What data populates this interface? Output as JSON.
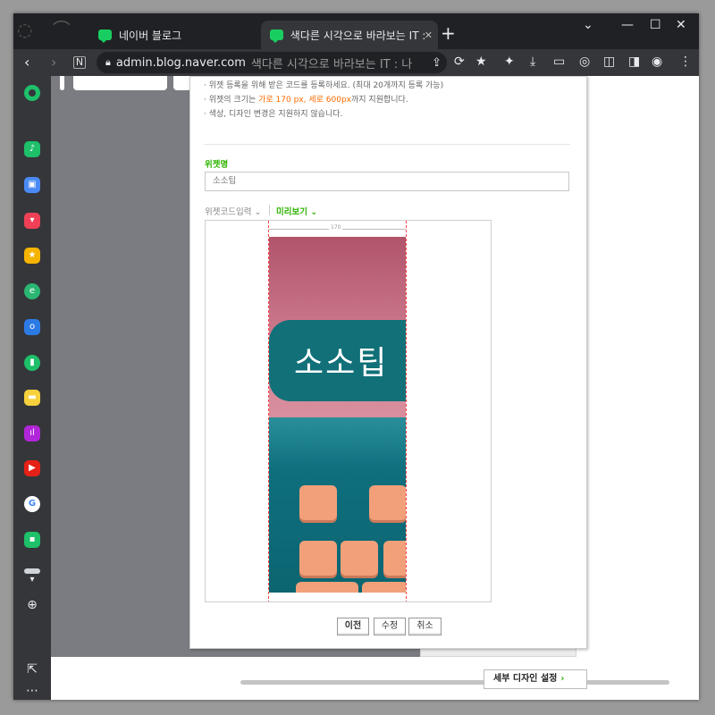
{
  "browser": {
    "tabs": [
      {
        "label": "네이버 블로그"
      },
      {
        "label": "색다른 시각으로 바라보는 IT : 나"
      }
    ],
    "new_tab_symbol": "+",
    "address": {
      "url": "admin.blog.naver.com",
      "page_title": "색다른 시각으로 바라보는 IT : 나"
    }
  },
  "window_controls": {
    "dropdown": "⌄",
    "minimize": "—",
    "maximize": "☐",
    "close": "✕"
  },
  "sidebar": {
    "items": [
      {
        "icon": "naver-whale-icon",
        "color": "#1ec06a"
      },
      {
        "icon": "bell-app-icon",
        "color": "#1ec06a"
      },
      {
        "icon": "briefcase-app-icon",
        "color": "#4a8af4"
      },
      {
        "icon": "pocket-app-icon",
        "color": "#ef4056"
      },
      {
        "icon": "star-app-icon",
        "color": "#f5b400"
      },
      {
        "icon": "edge-app-icon",
        "color": "#2bb673"
      },
      {
        "icon": "outlook-app-icon",
        "color": "#2c7be5"
      },
      {
        "icon": "bookmark-app-icon",
        "color": "#1ec06a"
      },
      {
        "icon": "notes-app-icon",
        "color": "#f7d13d"
      },
      {
        "icon": "podcast-app-icon",
        "color": "#b026d8"
      },
      {
        "icon": "youtube-app-icon",
        "color": "#e62117"
      },
      {
        "icon": "google-app-icon",
        "color": "#ffffff"
      },
      {
        "icon": "chat-app-icon",
        "color": "#1ec06a"
      }
    ]
  },
  "dialog": {
    "info_lines": [
      {
        "text": "위젯 등록을 위해 받은 코드를 등록하세요. (최대 20개까지 등록 가능)"
      },
      {
        "before": "위젯의 크기는 ",
        "highlight": "가로 170 px, 세로 600px",
        "after": "까지 지원합니다."
      },
      {
        "text": "색상, 디자인 변경은 지원하지 않습니다."
      }
    ],
    "widget_name_label": "위젯명",
    "widget_name_value": "소소팁",
    "code_input_tab": "위젯코드입력 ⌄",
    "preview_tab": "미리보기 ⌄",
    "preview": {
      "width_label": "170",
      "banner_text": "소소팁",
      "colors": {
        "top": "#b0546a",
        "middle": "#d88e9d",
        "teal": "#117078",
        "key": "#f1a07a"
      }
    },
    "buttons": {
      "prev": "이전",
      "edit": "수정",
      "cancel": "취소"
    }
  },
  "footer": {
    "detail_design_button": "세부 디자인 설정",
    "detail_arrow": "›"
  },
  "colors": {
    "naver_green": "#2db400",
    "accent_orange": "#ff6a00"
  }
}
